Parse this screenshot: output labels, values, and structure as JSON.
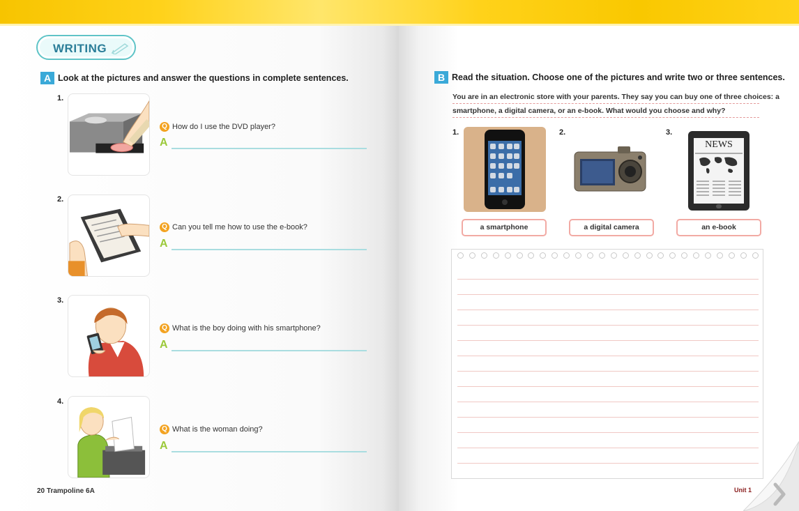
{
  "section_header": {
    "label": "WRITING"
  },
  "section_a": {
    "badge": "A",
    "instruction": "Look at the pictures and answer the questions in complete sentences.",
    "q_marker": "Q",
    "a_marker": "A",
    "items": [
      {
        "number": "1.",
        "question": "How do I use the DVD player?"
      },
      {
        "number": "2.",
        "question": "Can you tell me how to use the e-book?"
      },
      {
        "number": "3.",
        "question": "What is the boy doing with his smartphone?"
      },
      {
        "number": "4.",
        "question": "What is the woman doing?"
      }
    ]
  },
  "section_b": {
    "badge": "B",
    "instruction": "Read the situation. Choose one of the pictures and write two or three sentences.",
    "situation_line1": "You are in an electronic store with your parents. They say you can buy one of three choices: a",
    "situation_line2": "smartphone, a digital camera, or an e-book. What would you choose and why?",
    "choices": [
      {
        "number": "1.",
        "label": "a smartphone"
      },
      {
        "number": "2.",
        "label": "a digital camera"
      },
      {
        "number": "3.",
        "label": "an e-book"
      }
    ],
    "ebook_screen_text": "NEWS"
  },
  "footer": {
    "left": "20 Trampoline 6A",
    "right": "Unit 1"
  },
  "colors": {
    "top_bar": "#ffd21a",
    "badge_blue": "#3aa9d8",
    "answer_line": "#a9dde0",
    "choice_border": "#f2aaa4"
  }
}
